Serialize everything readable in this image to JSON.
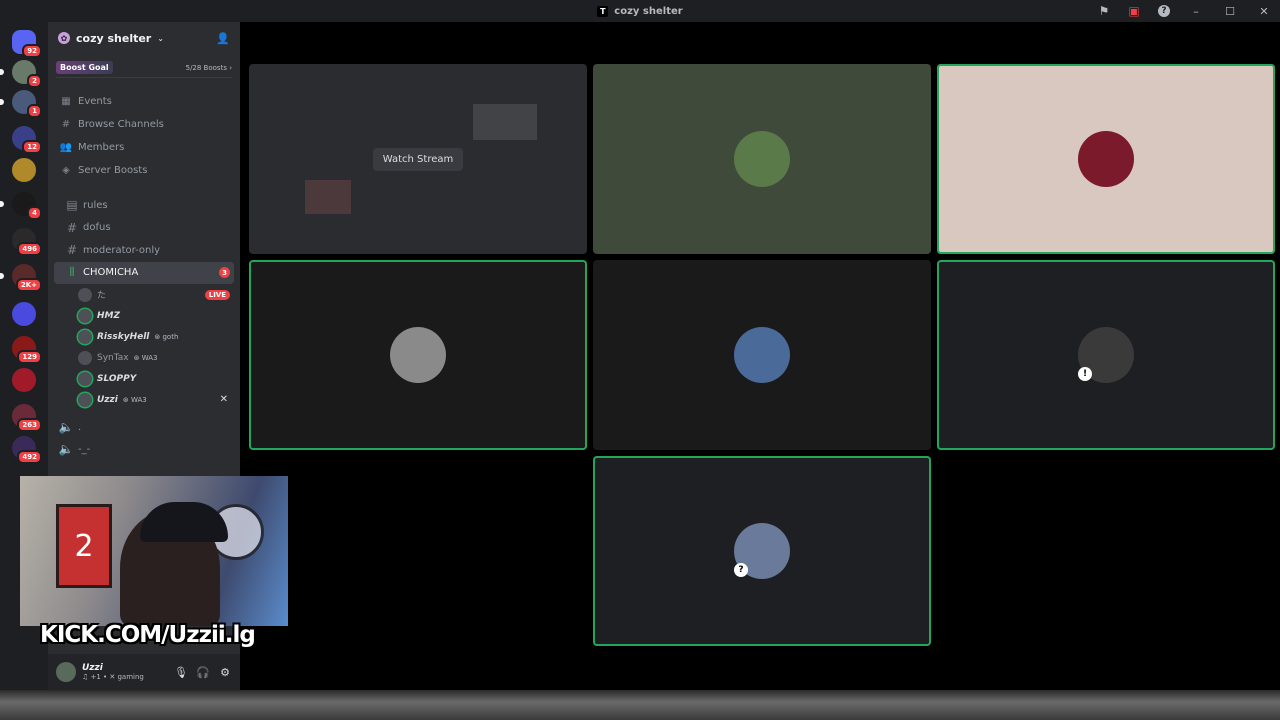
{
  "window": {
    "title": "cozy shelter"
  },
  "rail": {
    "servers": [
      {
        "name": "discord-home",
        "badge": "92",
        "color": "#5865f2"
      },
      {
        "name": "server-1",
        "badge": "2",
        "color": "#6a7a6a"
      },
      {
        "name": "server-2",
        "badge": "1",
        "color": "#4a5a7a"
      },
      {
        "name": "server-3",
        "badge": "12",
        "color": "#3a3f8a"
      },
      {
        "name": "server-4",
        "badge": "",
        "color": "#b08a2a"
      },
      {
        "name": "server-5",
        "badge": "4",
        "color": "#1a1a1a"
      },
      {
        "name": "server-folder-1",
        "badge": "496",
        "color": "#2a2a2a"
      },
      {
        "name": "server-6",
        "badge": "2K+",
        "color": "#5a2a2a"
      },
      {
        "name": "server-7",
        "badge": "",
        "color": "#4a4adf"
      },
      {
        "name": "server-8",
        "badge": "129",
        "color": "#8a1a1a"
      },
      {
        "name": "server-9",
        "badge": "",
        "color": "#a01a2a"
      },
      {
        "name": "server-10",
        "badge": "263",
        "color": "#6a2a3a"
      },
      {
        "name": "server-11",
        "badge": "492",
        "color": "#3a2a5a"
      }
    ]
  },
  "sidebar": {
    "guild_name": "cozy shelter",
    "boost": {
      "label": "Boost Goal",
      "count": "5/28 Boosts"
    },
    "nav": [
      {
        "icon": "calendar-icon",
        "label": "Events"
      },
      {
        "icon": "browse-icon",
        "label": "Browse Channels"
      },
      {
        "icon": "members-icon",
        "label": "Members"
      },
      {
        "icon": "boost-icon",
        "label": "Server Boosts"
      }
    ],
    "channels": [
      {
        "icon": "rules-icon",
        "label": "rules",
        "active": false
      },
      {
        "icon": "hashtag-icon",
        "label": "dofus",
        "active": false
      },
      {
        "icon": "hashtag-icon",
        "label": "moderator-only",
        "active": false
      },
      {
        "icon": "voice-icon",
        "label": "CHOMICHA",
        "active": true,
        "badge": "3"
      }
    ],
    "voice_users": [
      {
        "name": "た",
        "tag": "",
        "live": "LIVE",
        "dim": true,
        "speaking": false
      },
      {
        "name": "HMZ",
        "tag": "",
        "live": "",
        "dim": false,
        "speaking": true
      },
      {
        "name": "RisskyHell",
        "tag": "goth",
        "live": "",
        "dim": false,
        "speaking": true
      },
      {
        "name": "SynTax",
        "tag": "WA3",
        "live": "",
        "dim": true,
        "speaking": false
      },
      {
        "name": "SLOPPY",
        "tag": "",
        "live": "",
        "dim": false,
        "speaking": true
      },
      {
        "name": "Uzzi",
        "tag": "WA3",
        "live": "",
        "dim": false,
        "speaking": true
      }
    ],
    "sub_voice": [
      {
        "label": "."
      },
      {
        "label": "-_-"
      }
    ],
    "user": {
      "name": "Uzzi",
      "status": "♫ +1 • ✕ gaming"
    }
  },
  "webcam": {
    "jersey_number": "2",
    "overlay_text": "KICK.COM/Uzzii.lg"
  },
  "grid": {
    "watch_stream_label": "Watch Stream",
    "tiles": [
      {
        "id": "stream",
        "bg": "#2b2c30",
        "speaking": false
      },
      {
        "id": "user-a",
        "bg": "#3f4a3a",
        "speaking": false,
        "avatar": "#5a7a4a"
      },
      {
        "id": "user-b",
        "bg": "#d9c8bf",
        "speaking": true,
        "avatar": "#7a1a2a"
      },
      {
        "id": "user-c",
        "bg": "#1a1a1b",
        "speaking": true,
        "avatar": "#8a8a8a"
      },
      {
        "id": "user-d",
        "bg": "#1a1a1b",
        "speaking": false,
        "avatar": "#4a6a9a"
      },
      {
        "id": "user-e",
        "bg": "#1e1f22",
        "speaking": true,
        "avatar": "#3a3a3a",
        "deaf": "!"
      },
      {
        "id": "user-f",
        "bg": "#1e1f22",
        "speaking": true,
        "avatar": "#6a7a9a",
        "deaf": "?"
      }
    ]
  }
}
